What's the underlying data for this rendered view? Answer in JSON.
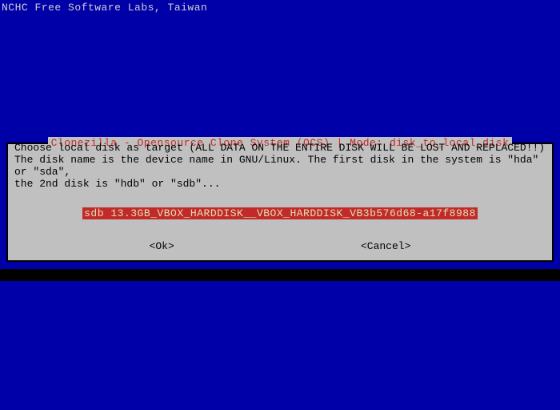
{
  "header": "NCHC Free Software Labs, Taiwan",
  "dialog": {
    "title": "Clonezilla - Opensource Clone System (OCS) | Mode: disk_to_local_disk",
    "body_line1": "Choose local disk as target (ALL DATA ON THE ENTIRE DISK WILL BE LOST AND REPLACED!!)",
    "body_line2": "The disk name is the device name in GNU/Linux. The first disk in the system is \"hda\" or \"sda\",",
    "body_line3": "the 2nd disk is \"hdb\" or \"sdb\"...",
    "selected_item": "sdb 13.3GB_VBOX_HARDDISK__VBOX_HARDDISK_VB3b576d68-a17f8988",
    "ok_label": "<Ok>",
    "cancel_label": "<Cancel>"
  }
}
